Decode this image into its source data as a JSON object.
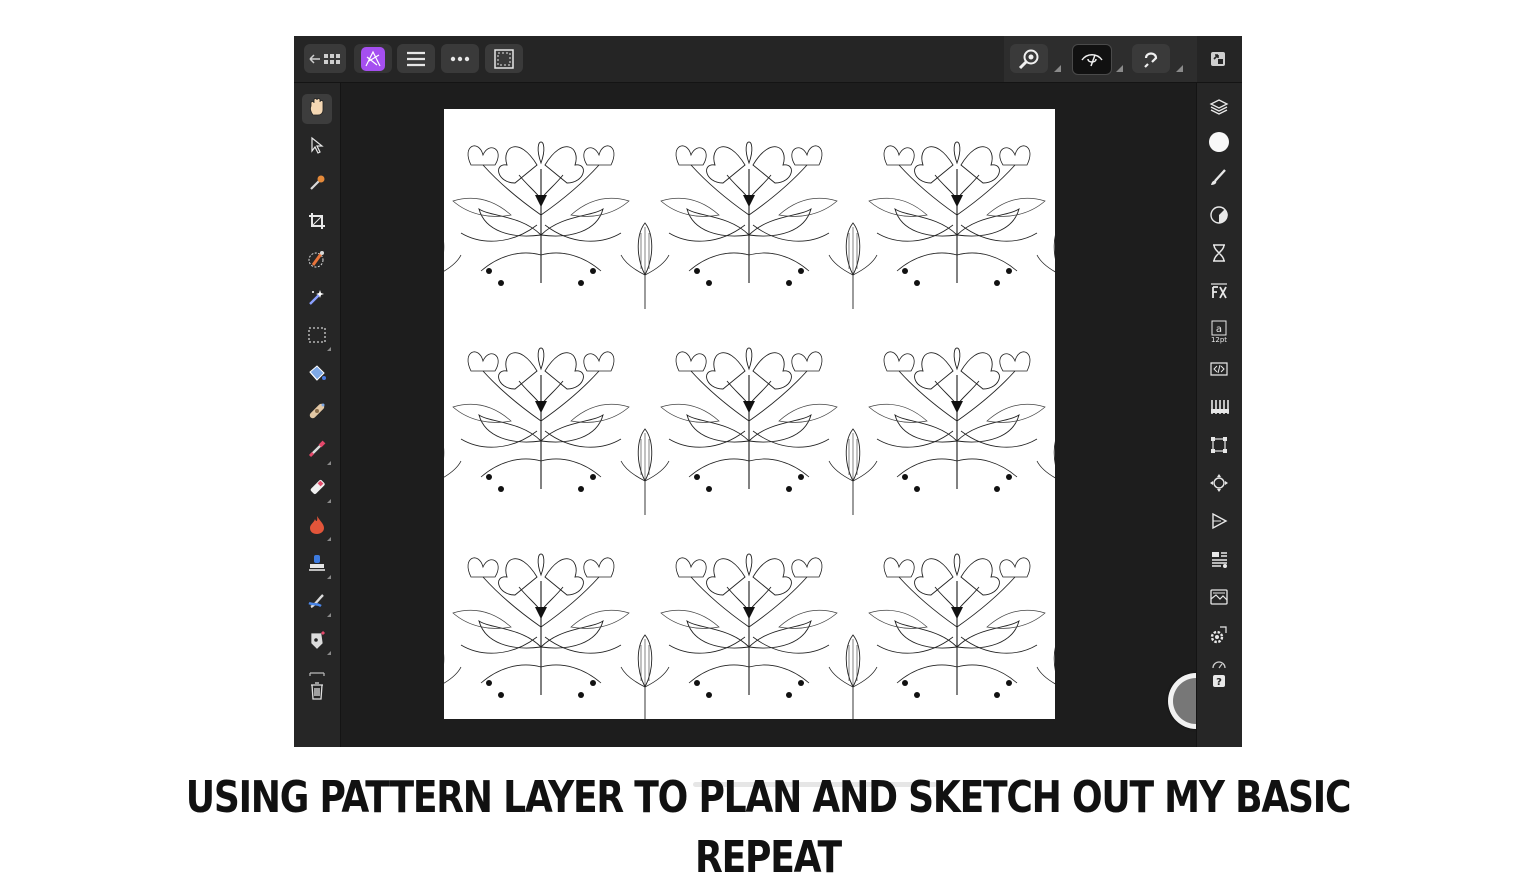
{
  "caption": "USING PATTERN LAYER TO PLAN AND SKETCH OUT MY BASIC REPEAT",
  "colors": {
    "app_background": "#1d1d1d",
    "toolbar": "#262626",
    "button": "#3a3a3a",
    "brand_purple": "#a54ff0",
    "document": "#ffffff",
    "record_button": "#777777"
  },
  "topbar": {
    "left_buttons": [
      "back-to-gallery-icon",
      "affinity-photo-logo-icon",
      "menu-icon",
      "more-options-icon",
      "selection-icon"
    ],
    "right_buttons": [
      "zoom-view-icon",
      "view-mode-icon",
      "snapping-icon",
      "fullscreen-icon"
    ]
  },
  "left_tools": [
    "hand-tool-icon",
    "move-tool-icon",
    "color-picker-tool-icon",
    "crop-tool-icon",
    "selection-brush-tool-icon",
    "flood-select-tool-icon",
    "marquee-tool-icon",
    "fill-tool-icon",
    "healing-tool-icon",
    "paint-brush-tool-icon",
    "erase-brush-tool-icon",
    "burn-tool-icon",
    "clone-tool-icon",
    "smudge-tool-icon",
    "pen-tool-icon",
    "trash-icon"
  ],
  "right_studios": [
    "layers-studio-icon",
    "color-studio-icon",
    "brushes-studio-icon",
    "adjustments-studio-icon",
    "history-studio-icon",
    "fx-studio-icon",
    "text-studio-icon",
    "macro-studio-icon",
    "channels-studio-icon",
    "transform-studio-icon",
    "navigator-studio-icon",
    "play-studio-icon",
    "stock-studio-icon",
    "snapshots-studio-icon",
    "settings-studio-icon",
    "help-studio-icon"
  ],
  "text_studio_size": "12pt"
}
